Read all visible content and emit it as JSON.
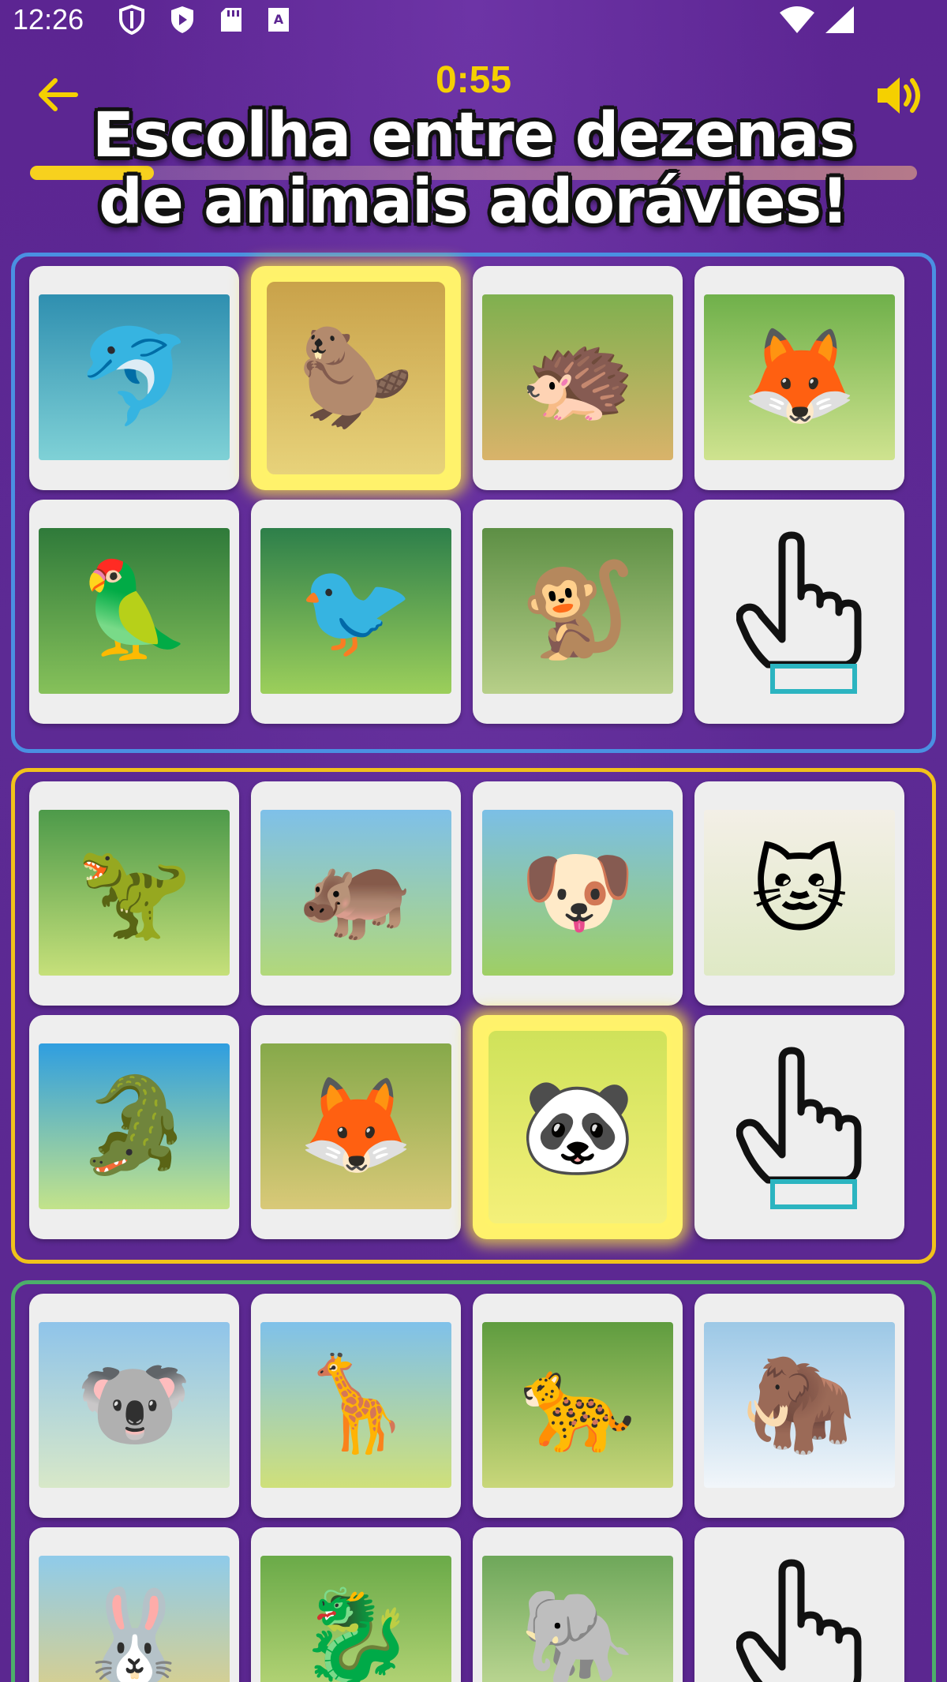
{
  "status_bar": {
    "time": "12:26",
    "icons": [
      "shield-icon",
      "play-protect-icon",
      "sd-card-icon",
      "keyboard-a-icon"
    ],
    "right_icons": [
      "wifi-icon",
      "signal-icon"
    ]
  },
  "header": {
    "timer": "0:55",
    "headline_line1": "Escolha entre dezenas",
    "headline_line2": "de animais adorávies!",
    "progress_fraction": 0.14,
    "accent": "#f5d000"
  },
  "groups": [
    {
      "border_color": "#4a90e2",
      "cards": [
        {
          "animal": "pink-dolphin",
          "scene": "underwater",
          "bg": [
            "#2f8fb0",
            "#7fd1d6"
          ],
          "selected": false
        },
        {
          "animal": "capybara",
          "scene": "meadow",
          "bg": [
            "#c9a24a",
            "#e7d27a"
          ],
          "selected": true
        },
        {
          "animal": "armadillo",
          "scene": "meadow",
          "bg": [
            "#7fb04f",
            "#d9b36a"
          ],
          "selected": false
        },
        {
          "animal": "maned-wolf",
          "scene": "forest",
          "bg": [
            "#6fb04a",
            "#cfe38f"
          ],
          "selected": false
        },
        {
          "animal": "blue-macaw",
          "scene": "jungle",
          "bg": [
            "#2f7a3a",
            "#86c15a"
          ],
          "selected": false
        },
        {
          "animal": "toucan",
          "scene": "jungle",
          "bg": [
            "#2d7f4a",
            "#9ccf5b"
          ],
          "selected": false
        },
        {
          "animal": "lemur",
          "scene": "forest",
          "bg": [
            "#5d8f45",
            "#b7cf88"
          ],
          "selected": false
        },
        {
          "animal": "tap-hint",
          "scene": "hand",
          "bg": [
            "#eeeeee",
            "#eeeeee"
          ],
          "selected": false
        }
      ]
    },
    {
      "border_color": "#f1c21b",
      "cards": [
        {
          "animal": "dinosaur",
          "scene": "jungle",
          "bg": [
            "#4d9a4a",
            "#c6e07a"
          ],
          "selected": false
        },
        {
          "animal": "hippo",
          "scene": "flowers",
          "bg": [
            "#7ec0e9",
            "#b2d87a"
          ],
          "selected": false
        },
        {
          "animal": "puppy",
          "scene": "garden",
          "bg": [
            "#7bbfe6",
            "#9fcf64"
          ],
          "selected": false
        },
        {
          "animal": "kitten",
          "scene": "meadow",
          "bg": [
            "#f3efe6",
            "#dfe9c5"
          ],
          "selected": false
        },
        {
          "animal": "crocodile",
          "scene": "tropical",
          "bg": [
            "#2f9ee0",
            "#c3e38a"
          ],
          "selected": false
        },
        {
          "animal": "fox",
          "scene": "forest",
          "bg": [
            "#86a94a",
            "#d9c978"
          ],
          "selected": false
        },
        {
          "animal": "panda",
          "scene": "bamboo",
          "bg": [
            "#cfe25a",
            "#f4f07a"
          ],
          "selected": true
        },
        {
          "animal": "tap-hint",
          "scene": "hand",
          "bg": [
            "#eeeeee",
            "#eeeeee"
          ],
          "selected": false
        }
      ]
    },
    {
      "border_color": "#4caf6a",
      "cards": [
        {
          "animal": "koala",
          "scene": "tree",
          "bg": [
            "#8fc4ea",
            "#d8e8c8"
          ],
          "selected": false
        },
        {
          "animal": "giraffe",
          "scene": "savanna",
          "bg": [
            "#7fc1ea",
            "#cfe07a"
          ],
          "selected": false
        },
        {
          "animal": "leopard",
          "scene": "meadow",
          "bg": [
            "#5f9c3f",
            "#c9d77a"
          ],
          "selected": false
        },
        {
          "animal": "mammoth",
          "scene": "snow",
          "bg": [
            "#9cc8e6",
            "#f2f6fa"
          ],
          "selected": false
        },
        {
          "animal": "bunny",
          "scene": "garden",
          "bg": [
            "#8fcbea",
            "#e8d07a"
          ],
          "selected": false
        },
        {
          "animal": "baby-dragon",
          "scene": "forest",
          "bg": [
            "#6aaa48",
            "#c5dd80"
          ],
          "selected": false
        },
        {
          "animal": "elephant",
          "scene": "forest",
          "bg": [
            "#6ea75a",
            "#cfe2a0"
          ],
          "selected": false
        },
        {
          "animal": "tap-hint",
          "scene": "hand",
          "bg": [
            "#eeeeee",
            "#eeeeee"
          ],
          "selected": false
        }
      ]
    }
  ]
}
